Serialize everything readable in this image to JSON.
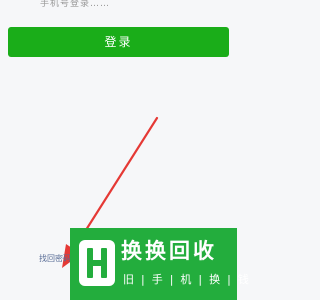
{
  "header": {
    "partial_text": "手机号登录……"
  },
  "login": {
    "button_label": "登录"
  },
  "footer": {
    "link_label": "找回密码"
  },
  "watermark": {
    "title": "换换回收",
    "subtitle": "旧|手|机|换|钱"
  },
  "colors": {
    "background": "#f6f7f9",
    "login_button": "#1aad19",
    "arrow": "#e53935",
    "link": "#576b95",
    "watermark_bg": "#23ad3d"
  },
  "icons": {
    "arrow": "red-arrow-icon",
    "watermark_logo": "h-logo-icon"
  }
}
